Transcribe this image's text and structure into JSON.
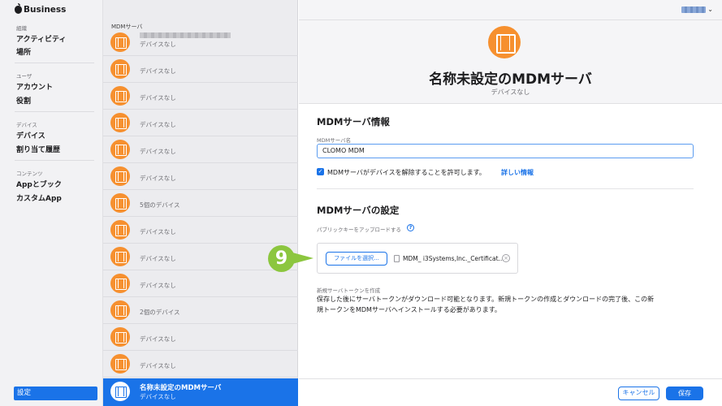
{
  "sidebar": {
    "brand": "Business",
    "groups": [
      {
        "label": "組織",
        "items": [
          "アクティビティ",
          "場所"
        ]
      },
      {
        "label": "ユーザ",
        "items": [
          "アカウント",
          "役割"
        ]
      },
      {
        "label": "デバイス",
        "items": [
          "デバイス",
          "割り当て履歴"
        ]
      },
      {
        "label": "コンテンツ",
        "items": [
          "Appとブック",
          "カスタムApp"
        ]
      }
    ],
    "settings_label": "設定"
  },
  "list": {
    "header": "MDMサーバ",
    "items": [
      {
        "subtitle": "デバイスなし",
        "name_redacted": true
      },
      {
        "subtitle": "デバイスなし"
      },
      {
        "subtitle": "デバイスなし"
      },
      {
        "subtitle": "デバイスなし"
      },
      {
        "subtitle": "デバイスなし"
      },
      {
        "subtitle": "デバイスなし"
      },
      {
        "subtitle": "5個のデバイス"
      },
      {
        "subtitle": "デバイスなし"
      },
      {
        "subtitle": "デバイスなし"
      },
      {
        "subtitle": "デバイスなし"
      },
      {
        "subtitle": "2個のデバイス"
      },
      {
        "subtitle": "デバイスなし"
      },
      {
        "subtitle": "デバイスなし"
      }
    ],
    "selected": {
      "title": "名称未設定のMDMサーバ",
      "subtitle": "デバイスなし"
    }
  },
  "topbar": {
    "user_chevron": "⌄"
  },
  "detail": {
    "title": "名称未設定のMDMサーバ",
    "subtitle": "デバイスなし",
    "info_section": {
      "heading": "MDMサーバ情報",
      "name_label": "MDMサーバ名",
      "name_value": "CLOMO MDM",
      "checkbox_label": "MDMサーバがデバイスを解除することを許可します。",
      "checkbox_checked": true,
      "link_label": "詳しい情報"
    },
    "settings_section": {
      "heading": "MDMサーバの設定",
      "upload_label": "パブリックキーをアップロードする",
      "help_glyph": "?",
      "file_button": "ファイルを選択...",
      "file_name": "MDM_ i3Systems,Inc._Certificat...",
      "clear_glyph": "×",
      "token_label": "新規サーバトークンを作成",
      "token_text": "保存した後にサーバトークンがダウンロード可能となります。新規トークンの作成とダウンロードの完了後、この新規トークンをMDMサーバへインストールする必要があります。"
    },
    "footer": {
      "cancel": "キャンセル",
      "save": "保存"
    }
  },
  "step_marker": "9",
  "colors": {
    "accent": "#1a73e8",
    "icon_orange": "#f6902f",
    "marker_green": "#8cc63f"
  }
}
